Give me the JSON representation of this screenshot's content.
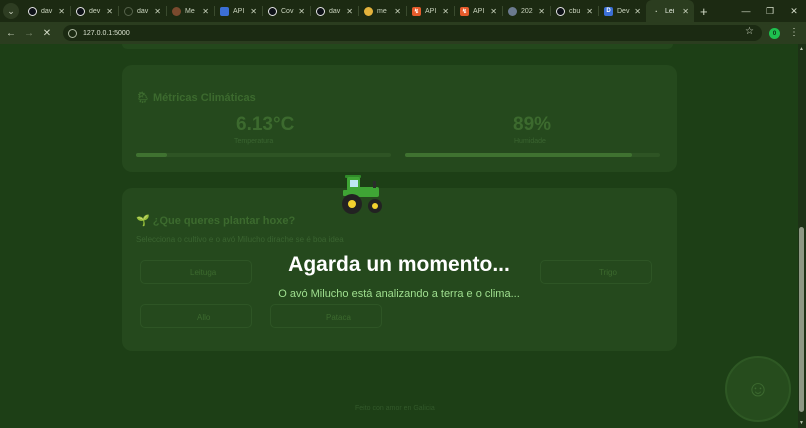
{
  "browser": {
    "tabs": [
      {
        "title": "dav",
        "icon": "github-icon",
        "kind": "gh"
      },
      {
        "title": "dev",
        "icon": "github-icon",
        "kind": "gh"
      },
      {
        "title": "dav",
        "icon": "blank-icon",
        "kind": "none"
      },
      {
        "title": "Me",
        "icon": "app-icon",
        "kind": "mix"
      },
      {
        "title": "API",
        "icon": "api-icon",
        "kind": "blue"
      },
      {
        "title": "Cov",
        "icon": "github-icon",
        "kind": "gh"
      },
      {
        "title": "dav",
        "icon": "github-icon",
        "kind": "gh"
      },
      {
        "title": "me",
        "icon": "mascot-icon",
        "kind": "yellow"
      },
      {
        "title": "API",
        "icon": "swagger-icon",
        "kind": "orange"
      },
      {
        "title": "API",
        "icon": "swagger-icon",
        "kind": "orange"
      },
      {
        "title": "202",
        "icon": "globe-icon",
        "kind": "globe"
      },
      {
        "title": "cbu",
        "icon": "github-icon",
        "kind": "gh"
      },
      {
        "title": "Dev",
        "icon": "dev-icon",
        "kind": "blue"
      },
      {
        "title": "Lei",
        "icon": "loading-icon",
        "kind": "dot",
        "active": true
      }
    ],
    "tab_close": "✕",
    "new_tab": "+",
    "url": "127.0.0.1:5000",
    "extension_badge": "0"
  },
  "page": {
    "climate_card_title": "🌦 Métricas Climáticas",
    "temperature_value": "6.13°C",
    "temperature_caption": "Temperatura",
    "humidity_value": "89%",
    "humidity_caption": "Humidade",
    "temperature_level": 0.12,
    "humidity_level": 0.89,
    "plant_card_title": "🌱 ¿Que queres plantar hoxe?",
    "plant_card_subtitle": "Selecciona o cultivo e o avó Milucho dirache se é boa idea",
    "crops": [
      "Leituga",
      "Trigo",
      "Allo",
      "Pataca"
    ],
    "footer": "Feito con amor en Galicia"
  },
  "overlay": {
    "title": "Agarda un momento...",
    "subtitle": "O avó Milucho está analizando a terra e o clima..."
  },
  "colors": {
    "background": "#1a3a12",
    "tractor_body": "#3fa535",
    "wheel_hub": "#f2d22e",
    "subtitle_text": "#9fdf8f"
  }
}
